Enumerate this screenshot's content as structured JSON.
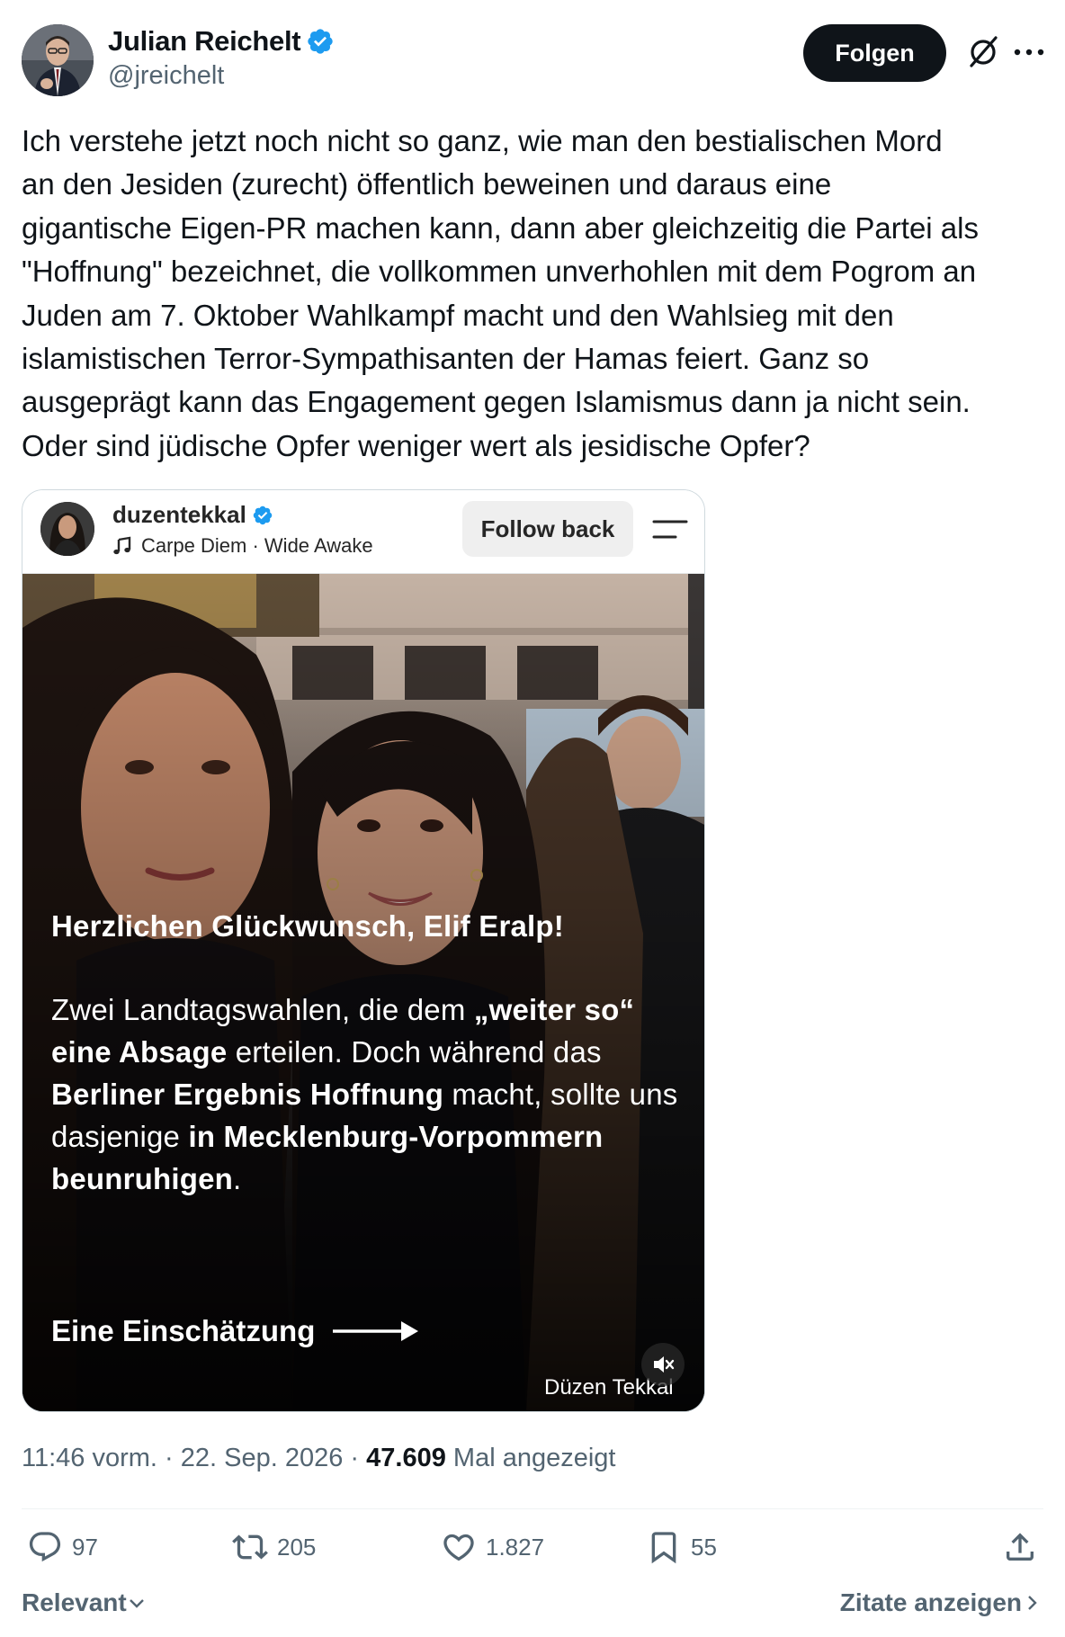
{
  "post": {
    "author_name": "Julian Reichelt",
    "author_handle": "@jreichelt",
    "follow_label": "Folgen",
    "text": "Ich verstehe jetzt noch nicht so ganz, wie man den bestialischen Mord\nan den Jesiden (zurecht) öffentlich beweinen und daraus eine\ngigantische Eigen-PR machen kann, dann aber gleichzeitig die Partei als\n\"Hoffnung\" bezeichnet, die vollkommen unverhohlen mit dem Pogrom an\nJuden am 7. Oktober Wahlkampf macht und den Wahlsieg mit den\nislamistischen Terror-Sympathisanten der Hamas feiert. Ganz so\nausgeprägt kann das Engagement gegen Islamismus dann ja nicht sein.\nOder sind jüdische Opfer weniger wert als jesidische Opfer?"
  },
  "embed": {
    "username": "duzentekkal",
    "music": "Carpe Diem · Wide Awake",
    "follow_back_label": "Follow back",
    "overlay_title": "Herzlichen Glückwunsch, Elif Eralp!",
    "overlay_body": {
      "p1": "Zwei Landtagswahlen, die dem ",
      "b1": "„weiter so“ eine Absage",
      "p2": " erteilen. Doch während das ",
      "b2": "Berliner Ergebnis Hoffnung",
      "p3": " macht, sollte uns dasjenige ",
      "b3": "in Mecklenburg-Vorpommern beunruhigen",
      "p4": "."
    },
    "cta": "Eine Einschätzung",
    "watermark": "Düzen Tekkal"
  },
  "meta": {
    "time": "11:46 vorm.",
    "sep1": " · ",
    "date": "22. Sep. 2026",
    "sep2": " · ",
    "views": "47.609",
    "views_label": " Mal angezeigt"
  },
  "actions": {
    "replies": "97",
    "reposts": "205",
    "likes": "1.827",
    "bookmarks": "55"
  },
  "footer": {
    "sort_label": "Relevant",
    "quotes_label": "Zitate anzeigen"
  },
  "colors": {
    "text": "#0f1419",
    "secondary": "#536471",
    "verified": "#1d9bf0",
    "button": "#0f1419"
  },
  "icons": [
    "verified-badge-icon",
    "grok-icon",
    "more-icon",
    "music-note-icon",
    "menu-icon",
    "arrow-right-icon",
    "mute-icon",
    "reply-icon",
    "repost-icon",
    "like-icon",
    "bookmark-icon",
    "share-icon",
    "chevron-down-icon",
    "chevron-right-icon"
  ]
}
